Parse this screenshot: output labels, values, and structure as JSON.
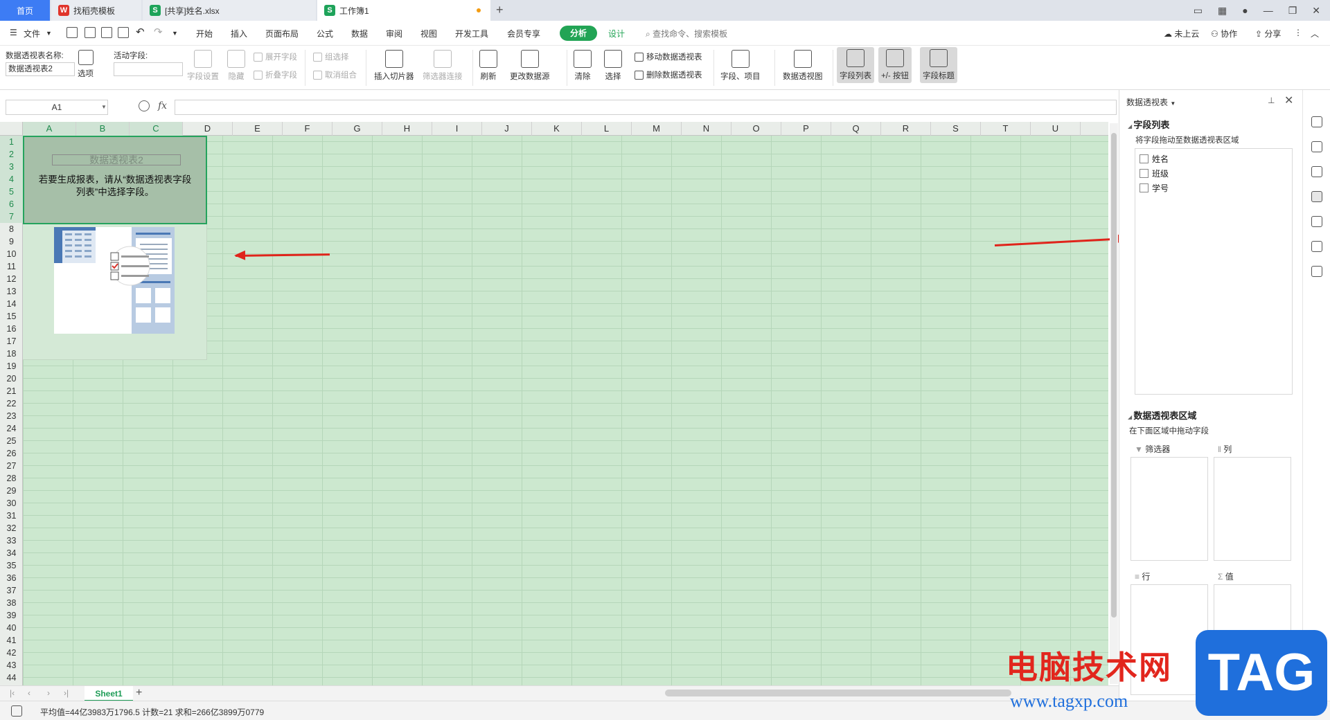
{
  "tabs": {
    "home": "首页",
    "template": "找稻壳模板",
    "shared": "[共享]姓名.xlsx",
    "book": "工作簿1",
    "add": "+"
  },
  "menu": {
    "file": "文件",
    "items": [
      "开始",
      "插入",
      "页面布局",
      "公式",
      "数据",
      "审阅",
      "视图",
      "开发工具",
      "会员专享"
    ],
    "analyze": "分析",
    "design": "设计",
    "search": "查找命令、搜索模板",
    "cloud": "未上云",
    "collab": "协作",
    "share": "分享"
  },
  "ribbon": {
    "pt_name_label": "数据透视表名称:",
    "pt_name_value": "数据透视表2",
    "options": "选项",
    "active_field_label": "活动字段:",
    "field_settings": "字段设置",
    "hide": "隐藏",
    "expand_field": "展开字段",
    "collapse_field": "折叠字段",
    "group_select": "组选择",
    "ungroup": "取消组合",
    "insert_slicer": "插入切片器",
    "filter_conn": "筛选器连接",
    "refresh": "刷新",
    "change_source": "更改数据源",
    "clear": "清除",
    "select": "选择",
    "move_pt": "移动数据透视表",
    "delete_pt": "删除数据透视表",
    "fields_items": "字段、项目",
    "pivot_chart": "数据透视图",
    "field_list": "字段列表",
    "plus_minus": "+/- 按钮",
    "field_header": "字段标题"
  },
  "formula": {
    "name_box": "A1",
    "fx": "fx",
    "value": ""
  },
  "grid": {
    "columns": [
      "A",
      "B",
      "C",
      "D",
      "E",
      "F",
      "G",
      "H",
      "I",
      "J",
      "K",
      "L",
      "M",
      "N",
      "O",
      "P",
      "Q",
      "R",
      "S",
      "T",
      "U"
    ],
    "rows": [
      "1",
      "2",
      "3",
      "4",
      "5",
      "6",
      "7",
      "8",
      "9",
      "10",
      "11",
      "12",
      "13",
      "14",
      "15",
      "16",
      "17",
      "18",
      "19",
      "20",
      "21",
      "22",
      "23",
      "24",
      "25",
      "26",
      "27",
      "28",
      "29",
      "30",
      "31",
      "32",
      "33",
      "34",
      "35",
      "36",
      "37",
      "38",
      "39",
      "40",
      "41",
      "42",
      "43",
      "44"
    ],
    "pt_title": "数据透视表2",
    "pt_hint_line1": "若要生成报表，请从“数据透视表字段",
    "pt_hint_line2": "列表”中选择字段。"
  },
  "sheets": {
    "active": "Sheet1",
    "add": "+"
  },
  "status": {
    "text": "平均值=44亿3983万1796.5  计数=21  求和=266亿3899万0779"
  },
  "panel": {
    "title": "数据透视表",
    "field_list_title": "字段列表",
    "field_list_hint": "将字段拖动至数据透视表区域",
    "fields": [
      "姓名",
      "班级",
      "学号"
    ],
    "areas_title": "数据透视表区域",
    "areas_hint": "在下面区域中拖动字段",
    "filter": "筛选器",
    "column": "列",
    "row": "行",
    "value": "值"
  },
  "watermark": {
    "text": "电脑技术网",
    "url": "www.tagxp.com",
    "logo": "TAG"
  },
  "colors": {
    "accent_green": "#22a455",
    "grid_bg": "#cce8cf",
    "arrow_red": "#e0241b"
  }
}
